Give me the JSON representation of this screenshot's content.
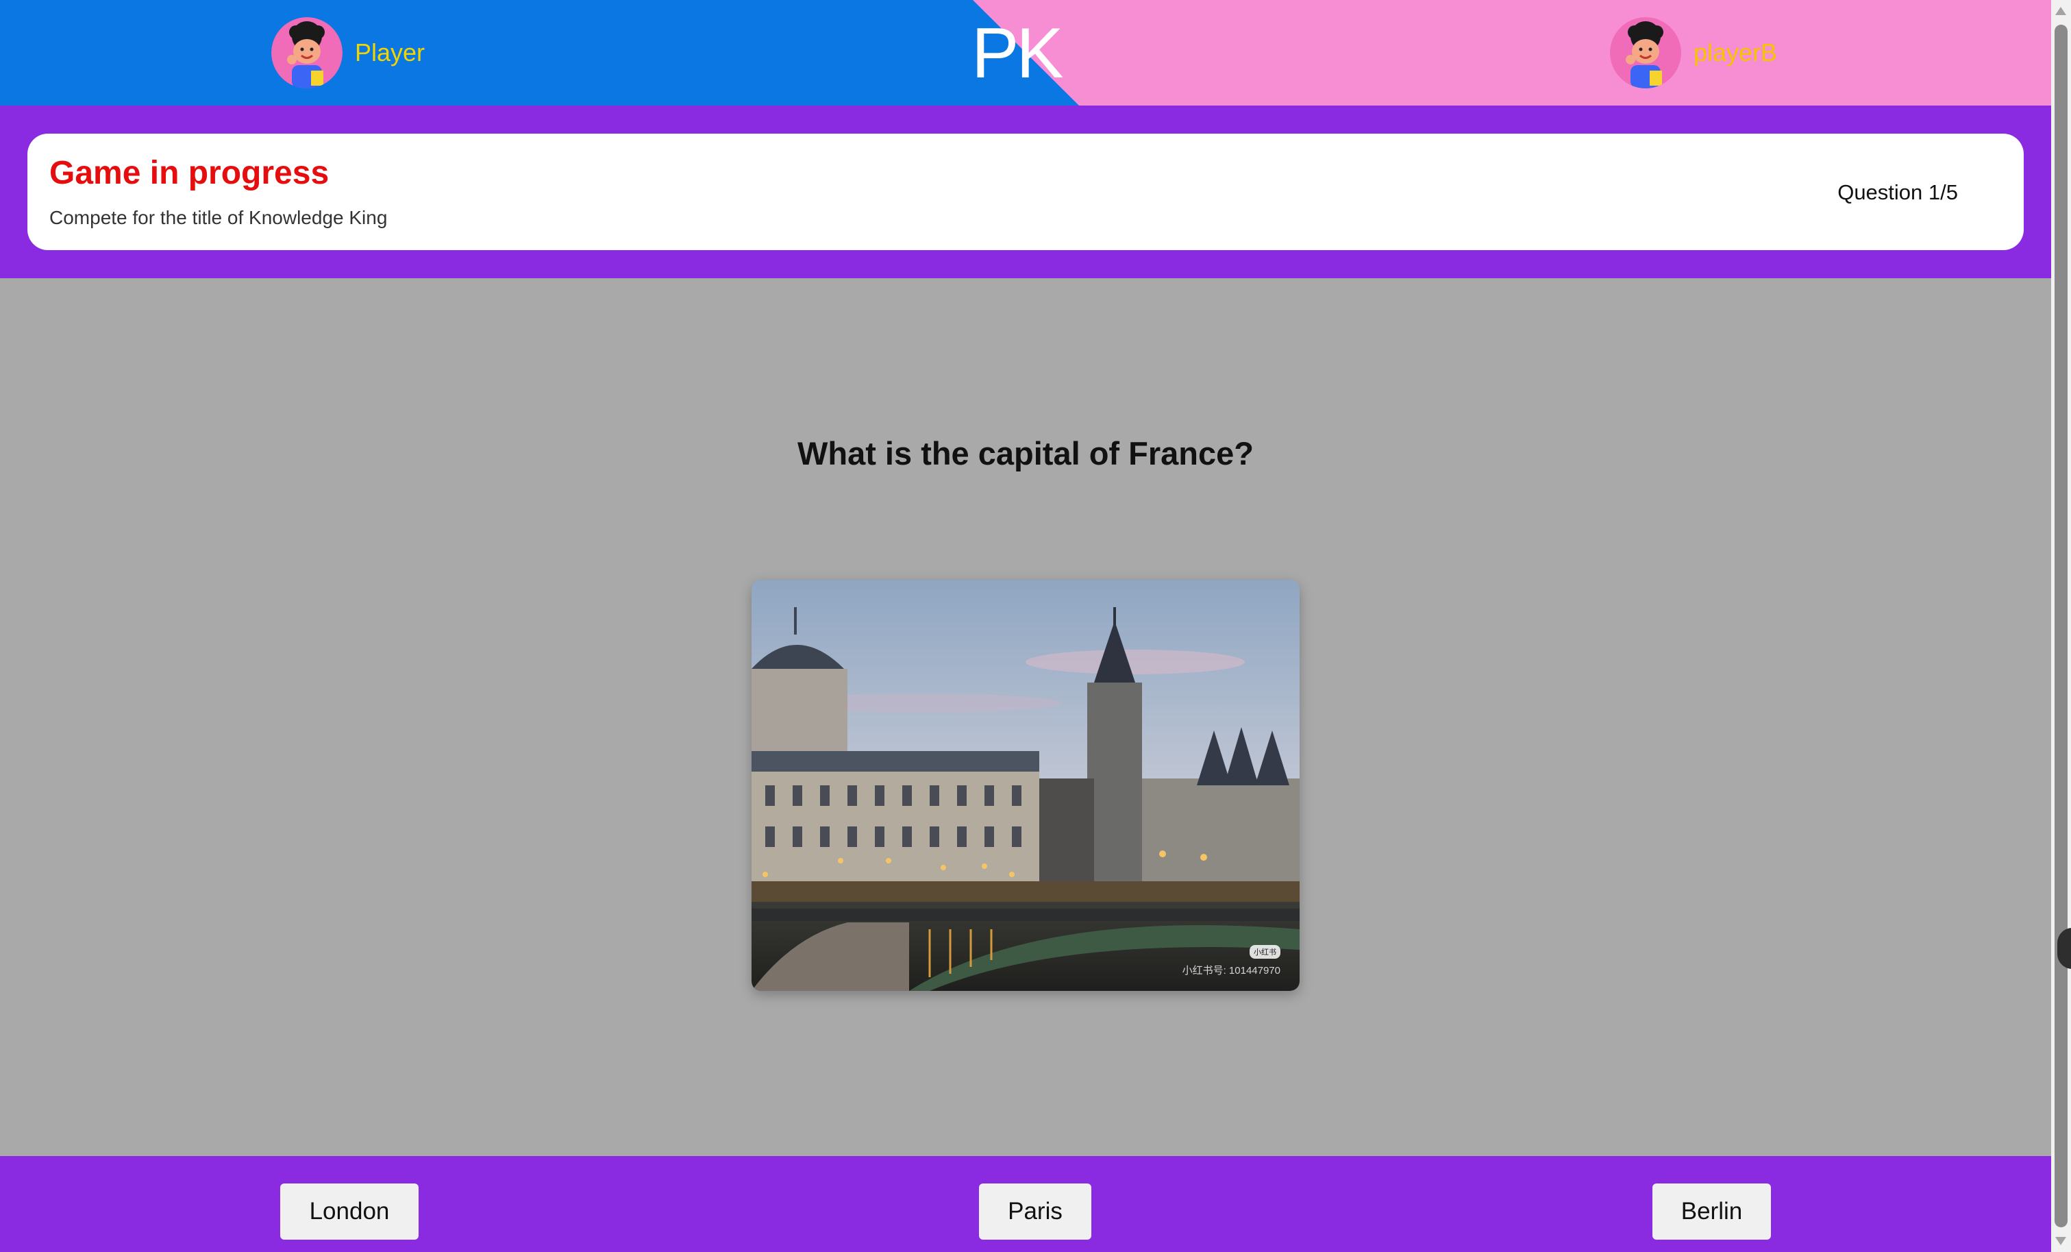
{
  "header": {
    "player_a": {
      "name": "Player",
      "avatar_icon": "cartoon-avatar-icon"
    },
    "center_label": "PK",
    "player_b": {
      "name": "playerB",
      "avatar_icon": "cartoon-avatar-icon"
    },
    "colors": {
      "left": "#0a77e2",
      "right": "#f78ed4",
      "name": "#f2d400"
    }
  },
  "status": {
    "title": "Game in progress",
    "subtitle": "Compete for the title of Knowledge King",
    "question_counter": "Question 1/5",
    "colors": {
      "band": "#8a2be2",
      "title": "#e50d0d"
    }
  },
  "question": {
    "text": "What is the capital of France?",
    "image": {
      "watermark_logo": "小红书",
      "watermark_text": "小红书号: 101447970"
    }
  },
  "answers": [
    {
      "label": "London"
    },
    {
      "label": "Paris"
    },
    {
      "label": "Berlin"
    }
  ]
}
